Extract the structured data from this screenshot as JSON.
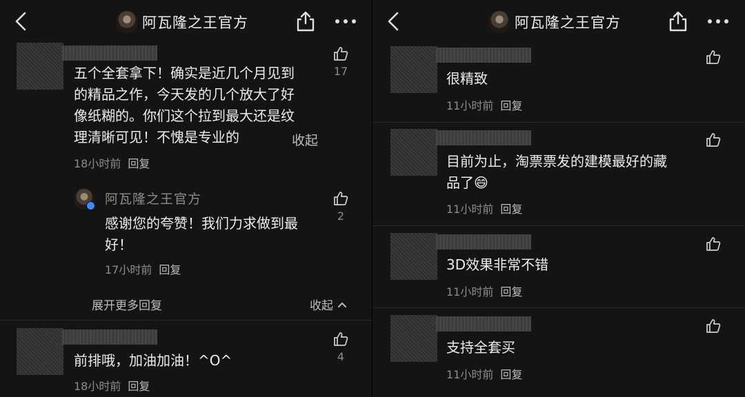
{
  "header": {
    "title": "阿瓦隆之王官方"
  },
  "left": {
    "comment1": {
      "text_lines": [
        "五个全套拿下！确实是近几个月见到",
        "的精品之作，今天发的几个放大了好",
        "像纸糊的。你们这个拉到最大还是纹",
        "理清晰可见！不愧是专业的"
      ],
      "collapse": "收起",
      "time": "18小时前",
      "reply": "回复",
      "likes": "17"
    },
    "official_reply": {
      "name": "阿瓦隆之王官方",
      "text_lines": [
        "感谢您的夸赞！我们力求做到最",
        "好！"
      ],
      "time": "17小时前",
      "reply": "回复",
      "likes": "2"
    },
    "expand_more": "展开更多回复",
    "fold": "收起",
    "comment2": {
      "text": "前排哦，加油加油！^O^",
      "time": "18小时前",
      "reply": "回复",
      "likes": "4"
    }
  },
  "right": {
    "comments": [
      {
        "text_lines": [
          "很精致"
        ],
        "time": "11小时前",
        "reply": "回复"
      },
      {
        "text_lines": [
          "目前为止，淘票票发的建模最好的藏",
          "品了😄"
        ],
        "time": "11小时前",
        "reply": "回复"
      },
      {
        "text_lines": [
          "3D效果非常不错"
        ],
        "time": "11小时前",
        "reply": "回复"
      },
      {
        "text_lines": [
          "支持全套买"
        ],
        "time": "11小时前",
        "reply": "回复"
      }
    ]
  },
  "icons": {
    "back": "chevron-left-icon",
    "share": "share-icon",
    "more": "more-dots-icon",
    "like": "thumbs-up-icon",
    "fold": "chevron-up-icon",
    "verified": "verified-badge-icon"
  },
  "colors": {
    "background": "#141414",
    "text": "#ececec",
    "muted": "#8c8c8c",
    "verified": "#3d8bff"
  }
}
